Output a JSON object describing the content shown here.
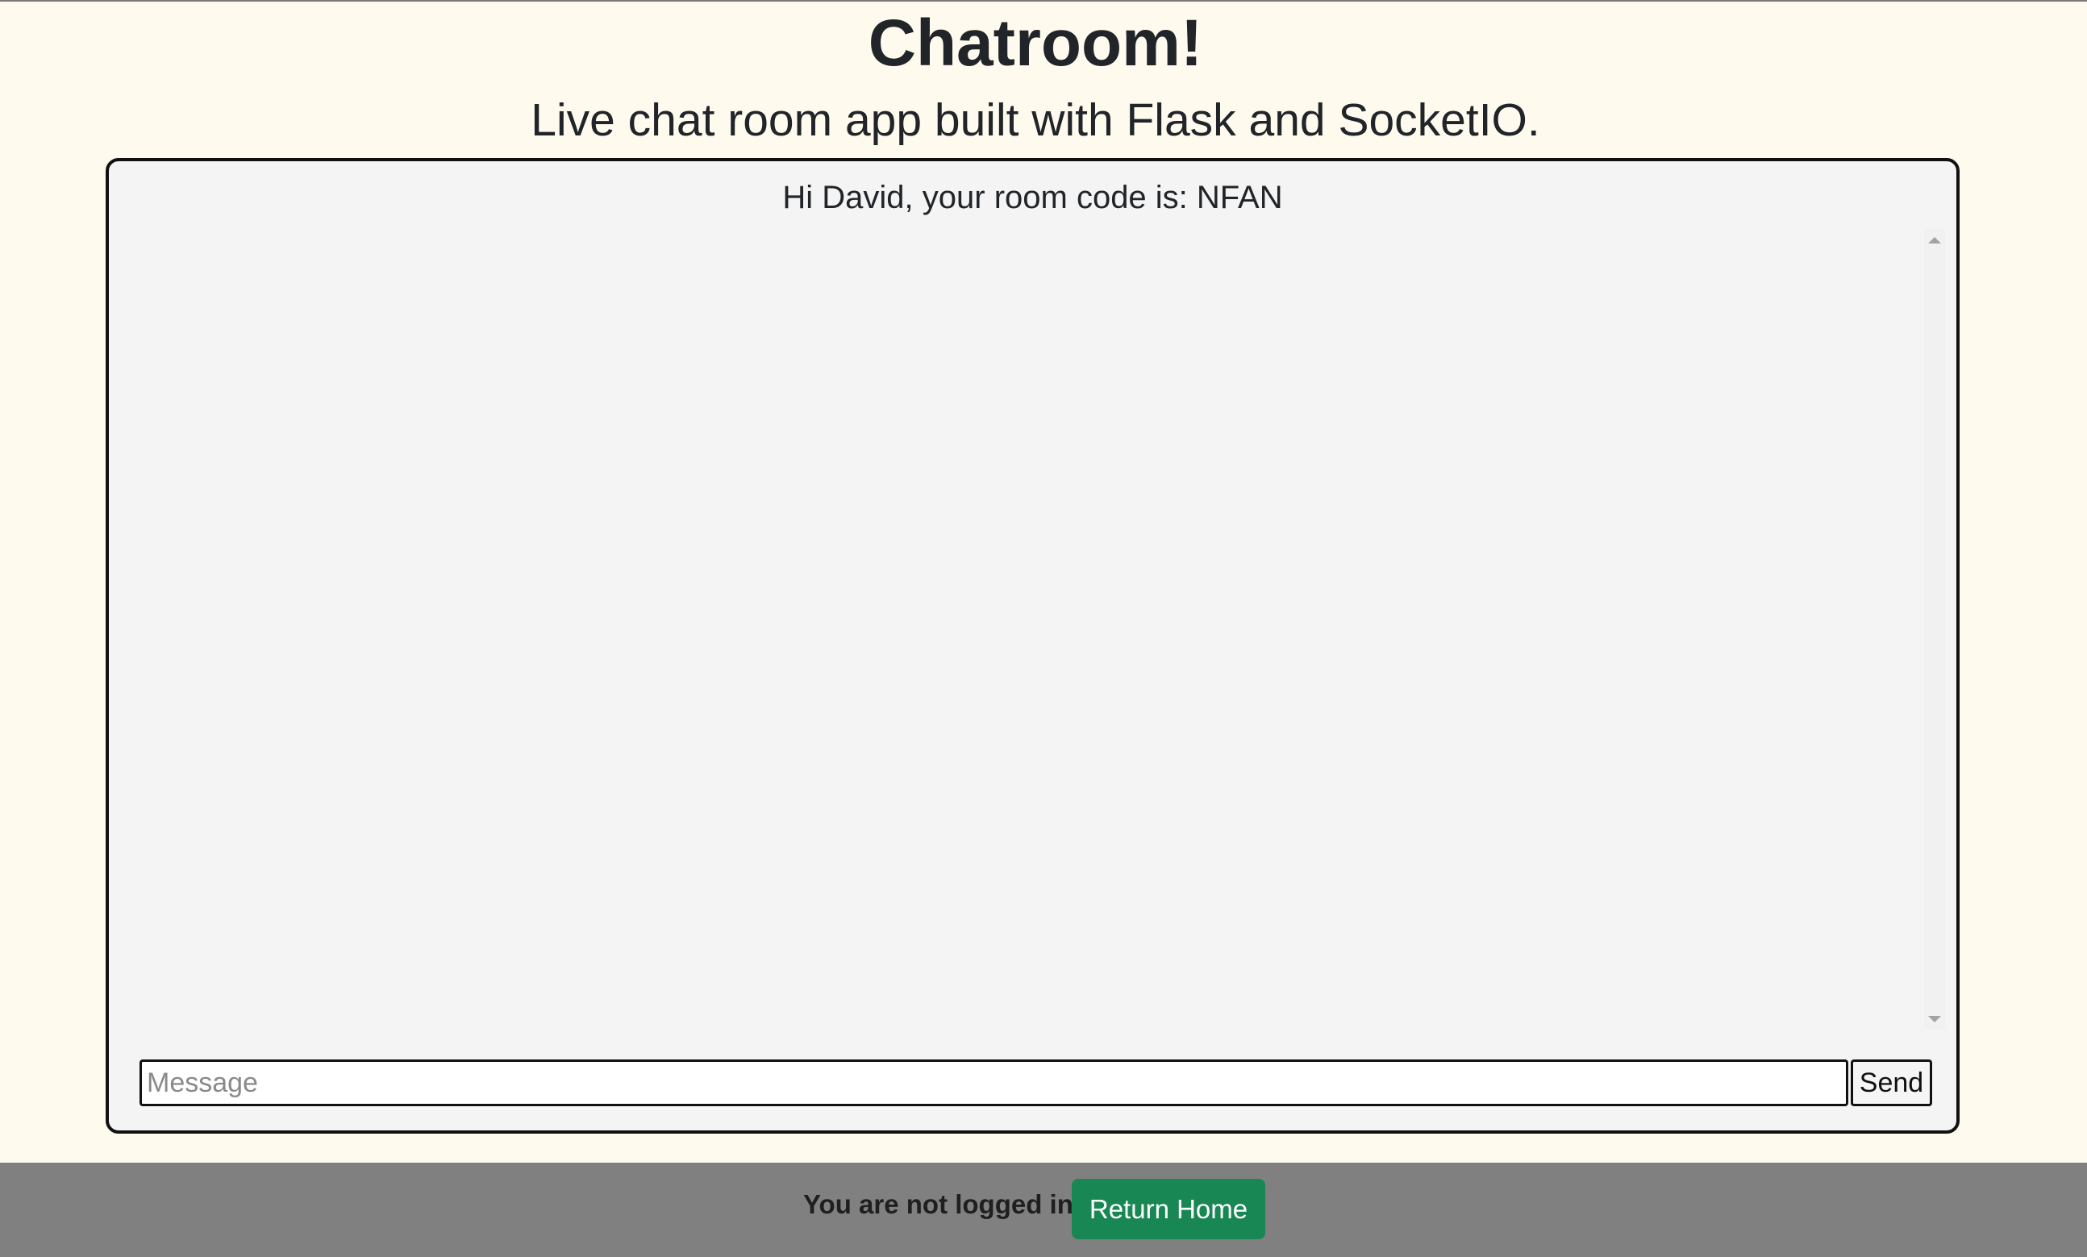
{
  "header": {
    "title": "Chatroom!",
    "subtitle": "Live chat room app built with Flask and SocketIO."
  },
  "chat": {
    "greeting": "Hi David, your room code is: NFAN",
    "messages": [],
    "input_value": "",
    "input_placeholder": "Message",
    "send_label": "Send"
  },
  "footer": {
    "status_text": "You are not logged in",
    "return_home_label": "Return Home"
  },
  "colors": {
    "page_background": "#fefaee",
    "panel_background": "#f4f4f4",
    "footer_background": "#808080",
    "accent_button": "#198754"
  }
}
